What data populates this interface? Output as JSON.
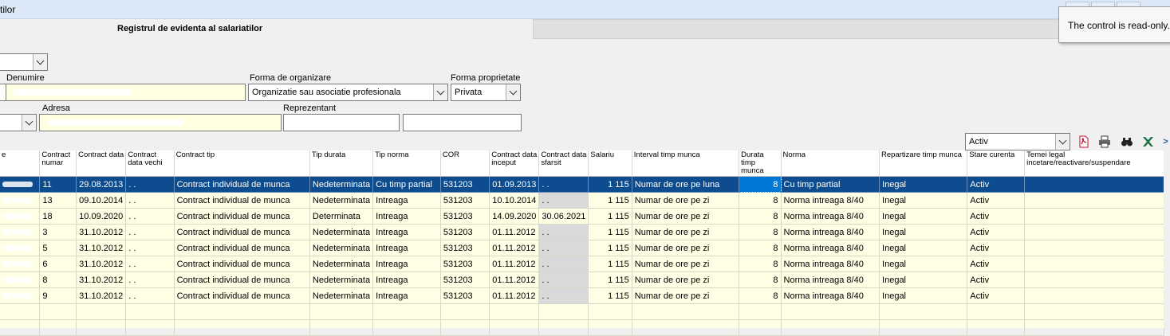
{
  "window": {
    "title": "tilor",
    "tooltip": "The control is read-only."
  },
  "form": {
    "title": "Registrul de evidenta al salariatilor",
    "denumire_label": "Denumire",
    "forma_org_label": "Forma de organizare",
    "forma_org_value": "Organizatie sau asociatie profesionala",
    "forma_prop_label": "Forma proprietate",
    "forma_prop_value": "Privata",
    "adresa_label": "Adresa",
    "reprezentant_label": "Reprezentant",
    "status_filter_value": "Activ"
  },
  "toolbar": {
    "icons": [
      "pdf-icon",
      "print-icon",
      "binoculars-icon",
      "excel-icon",
      "more-icon"
    ]
  },
  "colors": {
    "selected_row": "#0d4d8f",
    "grid_background": "#ffffe6",
    "field_yellow": "#ffffe1"
  },
  "table": {
    "columns": [
      "e",
      "Contract numar",
      "Contract data",
      "Contract data vechi",
      "Contract tip",
      "Tip durata",
      "Tip norma",
      "COR",
      "Contract data inceput",
      "Contract data sfarsit",
      "Salariu",
      "Interval timp munca",
      "Durata timp munca",
      "Norma",
      "Repartizare timp munca",
      "Stare curenta",
      "Temei legal incetare/reactivare/suspendare"
    ],
    "rows": [
      [
        "",
        "11",
        "29.08.2013",
        ". .",
        "Contract individual de munca",
        "Nedeterminata",
        "Cu timp partial",
        "531203",
        "01.09.2013",
        ". .",
        "1 115",
        "Numar de ore pe luna",
        "8",
        "Cu timp partial",
        "Inegal",
        "Activ",
        ""
      ],
      [
        "",
        "13",
        "09.10.2014",
        ". .",
        "Contract individual de munca",
        "Nedeterminata",
        "Intreaga",
        "531203",
        "10.10.2014",
        ". .",
        "1 115",
        "Numar de ore pe zi",
        "8",
        "Norma intreaga 8/40",
        "Inegal",
        "Activ",
        ""
      ],
      [
        "",
        "18",
        "10.09.2020",
        ". .",
        "Contract individual de munca",
        "Determinata",
        "Intreaga",
        "531203",
        "14.09.2020",
        "30.06.2021",
        "1 115",
        "Numar de ore pe zi",
        "8",
        "Norma intreaga 8/40",
        "Inegal",
        "Activ",
        ""
      ],
      [
        "",
        "3",
        "31.10.2012",
        ". .",
        "Contract individual de munca",
        "Nedeterminata",
        "Intreaga",
        "531203",
        "01.11.2012",
        ". .",
        "1 115",
        "Numar de ore pe zi",
        "8",
        "Norma intreaga 8/40",
        "Inegal",
        "Activ",
        ""
      ],
      [
        "",
        "5",
        "31.10.2012",
        ". .",
        "Contract individual de munca",
        "Nedeterminata",
        "Intreaga",
        "531203",
        "01.11.2012",
        ". .",
        "1 115",
        "Numar de ore pe zi",
        "8",
        "Norma intreaga 8/40",
        "Inegal",
        "Activ",
        ""
      ],
      [
        "",
        "6",
        "31.10.2012",
        ". .",
        "Contract individual de munca",
        "Nedeterminata",
        "Intreaga",
        "531203",
        "01.11.2012",
        ". .",
        "1 115",
        "Numar de ore pe zi",
        "8",
        "Norma intreaga 8/40",
        "Inegal",
        "Activ",
        ""
      ],
      [
        "",
        "8",
        "31.10.2012",
        ". .",
        "Contract individual de munca",
        "Nedeterminata",
        "Intreaga",
        "531203",
        "01.11.2012",
        ". .",
        "1 115",
        "Numar de ore pe zi",
        "8",
        "Norma intreaga 8/40",
        "Inegal",
        "Activ",
        ""
      ],
      [
        "",
        "9",
        "31.10.2012",
        ". .",
        "Contract individual de munca",
        "Nedeterminata",
        "Intreaga",
        "531203",
        "01.11.2012",
        ". .",
        "1 115",
        "Numar de ore pe zi",
        "8",
        "Norma intreaga 8/40",
        "Inegal",
        "Activ",
        ""
      ]
    ]
  }
}
